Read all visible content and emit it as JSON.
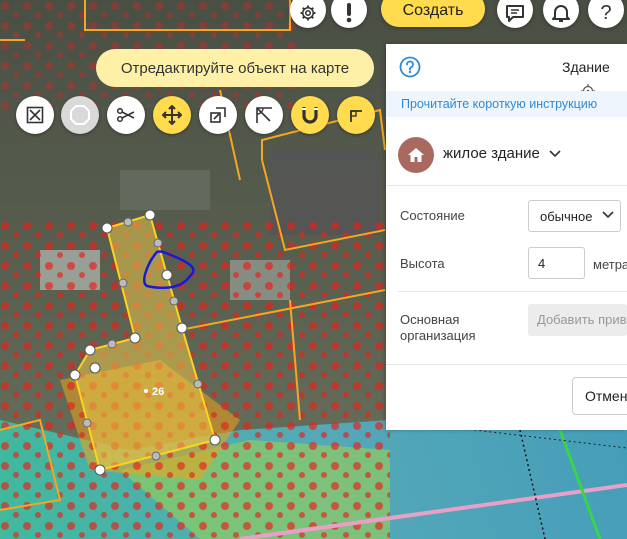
{
  "header": {
    "create_label": "Создать",
    "buttons": [
      {
        "name": "settings-button",
        "icon": "gear-icon"
      },
      {
        "name": "alert-button",
        "icon": "exclamation-icon"
      },
      {
        "name": "feedback-button",
        "icon": "chat-icon"
      },
      {
        "name": "notifications-button",
        "icon": "bell-icon"
      },
      {
        "name": "help-button",
        "icon": "question-icon",
        "glyph": "?"
      }
    ]
  },
  "hint": "Отредактируйте объект на карте",
  "toolbar": {
    "tools": [
      {
        "name": "delete-vertex",
        "icon": "cross-box-icon",
        "state": "normal"
      },
      {
        "name": "polygon",
        "icon": "octagon-icon",
        "state": "disabled"
      },
      {
        "name": "cut",
        "icon": "scissors-icon",
        "state": "normal"
      },
      {
        "name": "move",
        "icon": "move-arrows-icon",
        "state": "active"
      },
      {
        "name": "copy-geometry",
        "icon": "copy-shape-icon",
        "state": "normal"
      },
      {
        "name": "angle",
        "icon": "angle-icon",
        "state": "normal"
      },
      {
        "name": "magnet",
        "icon": "magnet-icon",
        "state": "active"
      },
      {
        "name": "right-angle",
        "icon": "right-angle-icon",
        "state": "active"
      }
    ]
  },
  "map": {
    "object_label": "26",
    "colors": {
      "outline": "#f5a623",
      "selected_fill": "#e8c64a",
      "selected_stroke": "#ffd21f",
      "drawn_line": "#1a1ad6",
      "hotspot": "#e8201a"
    }
  },
  "panel": {
    "title": "Здание",
    "instruction_link": "Прочитайте короткую инструкцию",
    "category": {
      "label": "жилое здание",
      "icon": "house-icon",
      "color": "#a9695f"
    },
    "fields": {
      "state_label": "Состояние",
      "state_value": "обычное",
      "height_label": "Высота",
      "height_value": "4",
      "height_unit": "метра",
      "org_label": "Основная организация",
      "org_button": "Добавить привязку"
    },
    "cancel_label": "Отменить"
  }
}
